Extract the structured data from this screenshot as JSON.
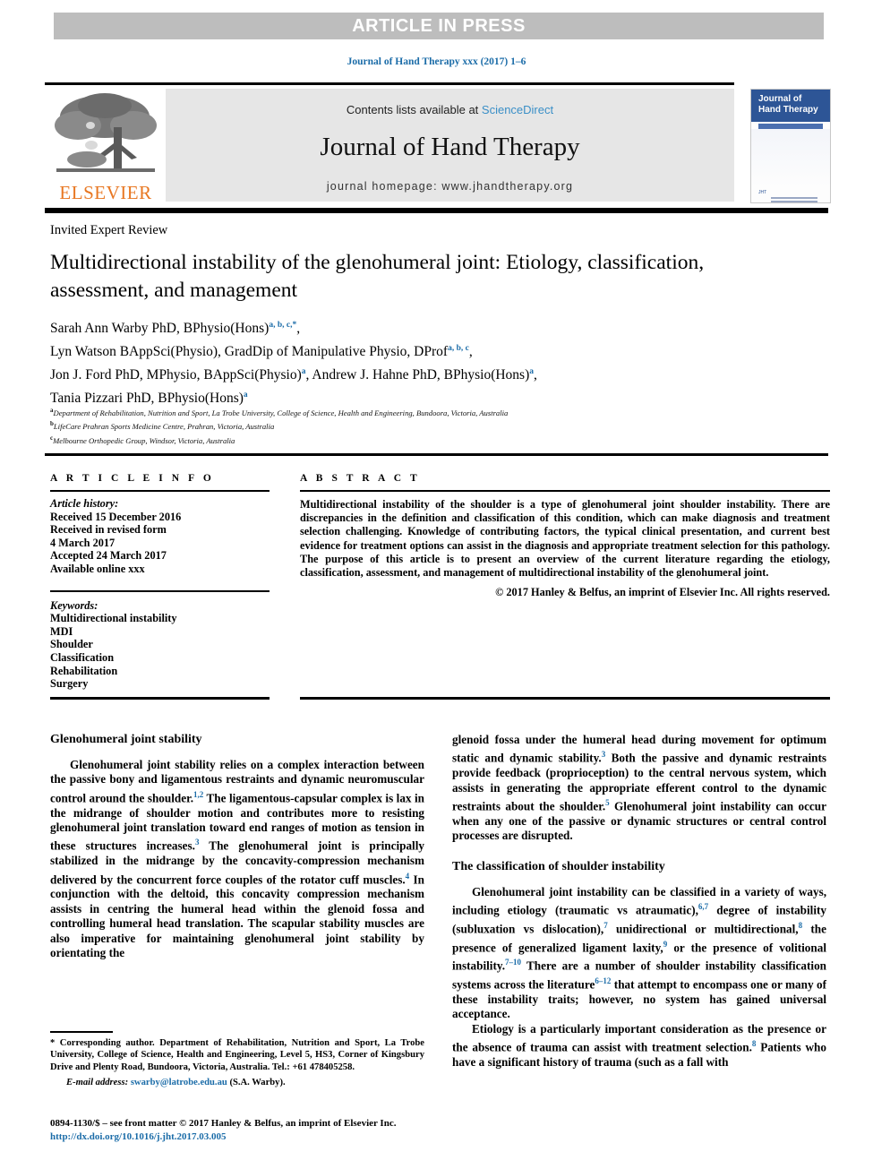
{
  "banner": {
    "text": "ARTICLE IN PRESS",
    "bg_color": "#bdbdbd",
    "text_color": "#ffffff"
  },
  "citation": {
    "text": "Journal of Hand Therapy xxx (2017) 1–6",
    "color": "#1b6ca8"
  },
  "masthead": {
    "publisher_name": "ELSEVIER",
    "publisher_color": "#e87722",
    "contents_prefix": "Contents lists available at ",
    "contents_link": "ScienceDirect",
    "journal_title": "Journal of Hand Therapy",
    "homepage": "journal homepage: www.jhandtherapy.org",
    "cover": {
      "line1": "Journal of",
      "line2": "Hand Therapy",
      "foot_mark": "JHT"
    }
  },
  "article": {
    "doctype": "Invited Expert Review",
    "title": "Multidirectional instability of the glenohumeral joint: Etiology, classification, assessment, and management",
    "authors": [
      {
        "name": "Sarah Ann Warby PhD, BPhysio(Hons)",
        "marks": "a, b, c,*",
        "trailing": ","
      },
      {
        "name": "Lyn Watson BAppSci(Physio), GradDip of Manipulative Physio, DProf",
        "marks": "a, b, c",
        "trailing": ","
      },
      {
        "name": "Jon J. Ford PhD, MPhysio, BAppSci(Physio)",
        "marks": "a",
        "trailing": ", Andrew J. Hahne PhD, BPhysio(Hons)"
      },
      {
        "name": "Tania Pizzari PhD, BPhysio(Hons)",
        "marks": "a",
        "trailing": ""
      }
    ],
    "author_extra_mark": "a",
    "author_line3_tail": ",",
    "affiliations": [
      {
        "mark": "a",
        "text": "Department of Rehabilitation, Nutrition and Sport, La Trobe University, College of Science, Health and Engineering, Bundoora, Victoria, Australia"
      },
      {
        "mark": "b",
        "text": "LifeCare Prahran Sports Medicine Centre, Prahran, Victoria, Australia"
      },
      {
        "mark": "c",
        "text": "Melbourne Orthopedic Group, Windsor, Victoria, Australia"
      }
    ]
  },
  "info": {
    "heading": "A R T I C L E  I N F O",
    "history_label": "Article history:",
    "history": [
      "Received 15 December 2016",
      "Received in revised form",
      "4 March 2017",
      "Accepted 24 March 2017",
      "Available online xxx"
    ],
    "keywords_label": "Keywords:",
    "keywords": [
      "Multidirectional instability",
      "MDI",
      "Shoulder",
      "Classification",
      "Rehabilitation",
      "Surgery"
    ]
  },
  "abstract": {
    "heading": "A B S T R A C T",
    "text": "Multidirectional instability of the shoulder is a type of glenohumeral joint shoulder instability. There are discrepancies in the definition and classification of this condition, which can make diagnosis and treatment selection challenging. Knowledge of contributing factors, the typical clinical presentation, and current best evidence for treatment options can assist in the diagnosis and appropriate treatment selection for this pathology. The purpose of this article is to present an overview of the current literature regarding the etiology, classification, assessment, and management of multidirectional instability of the glenohumeral joint.",
    "copyright": "© 2017 Hanley & Belfus, an imprint of Elsevier Inc. All rights reserved."
  },
  "body": {
    "left": {
      "section_heading": "Glenohumeral joint stability",
      "p1_a": "Glenohumeral joint stability relies on a complex interaction between the passive bony and ligamentous restraints and dynamic neuromuscular control around the shoulder.",
      "p1_ref1": "1,2",
      "p1_b": " The ligamentous-capsular complex is lax in the midrange of shoulder motion and contributes more to resisting glenohumeral joint translation toward end ranges of motion as tension in these structures increases.",
      "p1_ref2": "3",
      "p1_c": " The glenohumeral joint is principally stabilized in the midrange by the concavity-compression mechanism delivered by the concurrent force couples of the rotator cuff muscles.",
      "p1_ref3": "4",
      "p1_d": " In conjunction with the deltoid, this concavity compression mechanism assists in centring the humeral head within the glenoid fossa and controlling humeral head translation. The scapular stability muscles are also imperative for maintaining glenohumeral joint stability by orientating the"
    },
    "right": {
      "p1_a": "glenoid fossa under the humeral head during movement for optimum static and dynamic stability.",
      "p1_ref1": "3",
      "p1_b": " Both the passive and dynamic restraints provide feedback (proprioception) to the central nervous system, which assists in generating the appropriate efferent control to the dynamic restraints about the shoulder.",
      "p1_ref2": "5",
      "p1_c": " Glenohumeral joint instability can occur when any one of the passive or dynamic structures or central control processes are disrupted.",
      "section_heading": "The classification of shoulder instability",
      "p2_a": "Glenohumeral joint instability can be classified in a variety of ways, including etiology (traumatic vs atraumatic),",
      "p2_ref1": "6,7",
      "p2_b": " degree of instability (subluxation vs dislocation),",
      "p2_ref2": "7",
      "p2_c": " unidirectional or multidirectional,",
      "p2_ref3": "8",
      "p2_d": " the presence of generalized ligament laxity,",
      "p2_ref4": "9",
      "p2_e": " or the presence of volitional instability.",
      "p2_ref5": "7–10",
      "p2_f": " There are a number of shoulder instability classification systems across the literature",
      "p2_ref6": "6–12",
      "p2_g": " that attempt to encompass one or many of these instability traits; however, no system has gained universal acceptance.",
      "p3_a": "Etiology is a particularly important consideration as the presence or the absence of trauma can assist with treatment selection.",
      "p3_ref1": "8",
      "p3_b": " Patients who have a significant history of trauma (such as a fall with"
    }
  },
  "footnotes": {
    "corresponding": "* Corresponding author. Department of Rehabilitation, Nutrition and Sport, La Trobe University, College of Science, Health and Engineering, Level 5, HS3, Corner of Kingsbury Drive and Plenty Road, Bundoora, Victoria, Australia. Tel.: +61 478405258.",
    "email_label": "E-mail address:",
    "email": "swarby@latrobe.edu.au",
    "email_suffix": "(S.A. Warby).",
    "issn": "0894-1130/$ – see front matter © 2017 Hanley & Belfus, an imprint of Elsevier Inc.",
    "doi": "http://dx.doi.org/10.1016/j.jht.2017.03.005"
  },
  "colors": {
    "link": "#1b6ca8",
    "banner_gray": "#bdbdbd",
    "box_gray": "#e6e6e6",
    "elsevier_orange": "#e87722",
    "cover_blue": "#2d5596"
  }
}
